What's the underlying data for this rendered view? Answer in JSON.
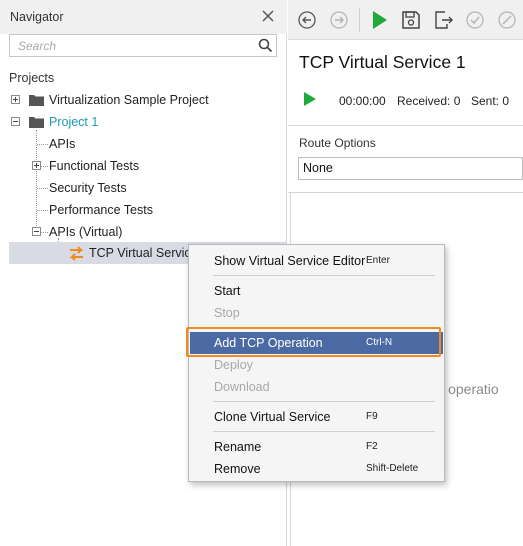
{
  "navigator": {
    "title": "Navigator",
    "search_placeholder": "Search",
    "projects_label": "Projects",
    "tree": {
      "virtualization_sample": "Virtualization Sample Project",
      "project1": "Project 1",
      "apis": "APIs",
      "functional_tests": "Functional Tests",
      "security_tests": "Security Tests",
      "performance_tests": "Performance Tests",
      "apis_virtual": "APIs (Virtual)",
      "tcp_virtual_service": "TCP Virtual Service"
    }
  },
  "editor": {
    "title": "TCP Virtual Service 1",
    "time": "00:00:00",
    "received": "Received: 0",
    "sent": "Sent: 0",
    "route_options_label": "Route Options",
    "route_options_value": "None",
    "empty_hint": "CP operatio"
  },
  "context_menu": {
    "show_editor": "Show Virtual Service Editor",
    "show_editor_shortcut": "Enter",
    "start": "Start",
    "stop": "Stop",
    "add_tcp_operation": "Add TCP Operation",
    "add_tcp_operation_shortcut": "Ctrl-N",
    "deploy": "Deploy",
    "download": "Download",
    "clone": "Clone Virtual Service",
    "clone_shortcut": "F9",
    "rename": "Rename",
    "rename_shortcut": "F2",
    "remove": "Remove",
    "remove_shortcut": "Shift-Delete"
  },
  "colors": {
    "accent_teal": "#1a9bb0",
    "menu_highlight": "#4b6aa3",
    "callout_orange": "#f08c1e",
    "play_green": "#1faa3c"
  }
}
